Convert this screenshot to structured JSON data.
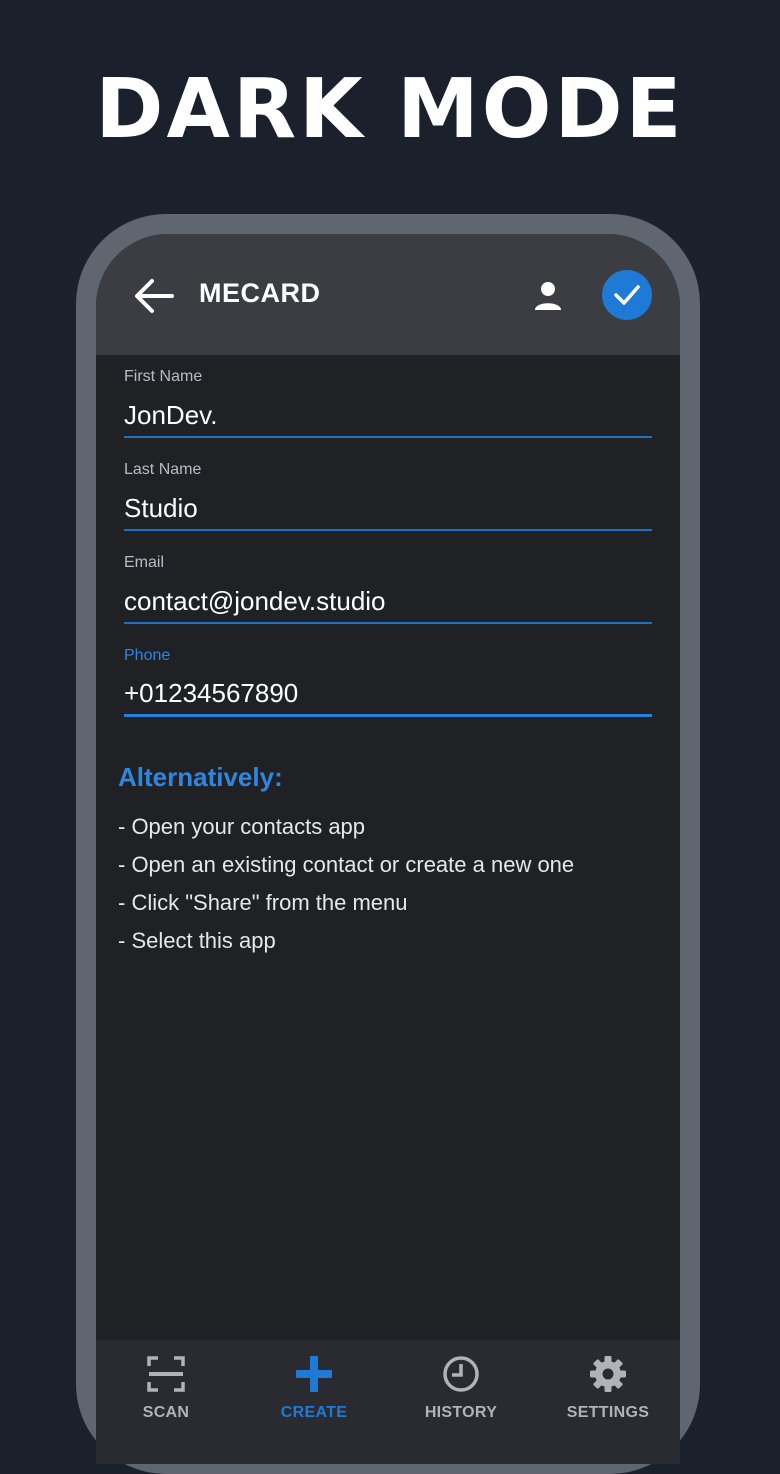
{
  "promo": {
    "title": "DARK MODE"
  },
  "appbar": {
    "title": "MECARD"
  },
  "form": {
    "first_name": {
      "label": "First Name",
      "value": "JonDev."
    },
    "last_name": {
      "label": "Last Name",
      "value": "Studio"
    },
    "email": {
      "label": "Email",
      "value": "contact@jondev.studio"
    },
    "phone": {
      "label": "Phone",
      "value": "+01234567890"
    }
  },
  "alternatively": {
    "heading": "Alternatively:",
    "steps": [
      "- Open your contacts app",
      "- Open an existing contact or create a new one",
      "- Click \"Share\" from the menu",
      "- Select this app"
    ]
  },
  "nav": {
    "items": [
      {
        "label": "SCAN",
        "icon": "scan-icon"
      },
      {
        "label": "CREATE",
        "icon": "plus-icon",
        "active": true
      },
      {
        "label": "HISTORY",
        "icon": "clock-icon"
      },
      {
        "label": "SETTINGS",
        "icon": "gear-icon"
      }
    ]
  },
  "colors": {
    "background": "#1b202d",
    "accent": "#1f7ad6",
    "surface": "#202125",
    "appbar": "#3c3d42"
  }
}
